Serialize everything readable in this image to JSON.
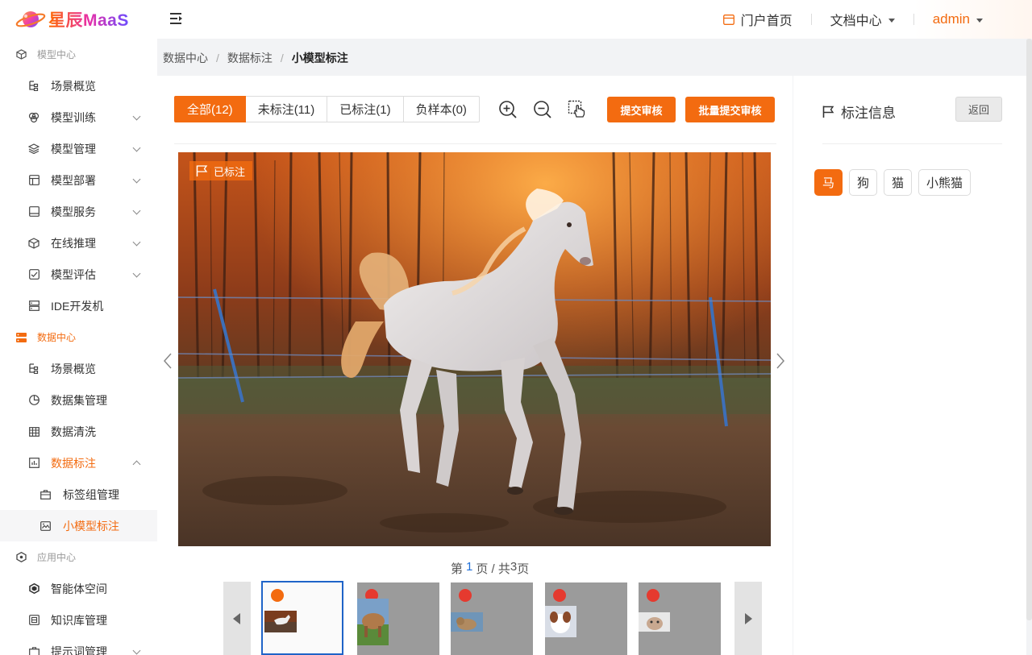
{
  "header": {
    "brand": "星辰MaaS",
    "nav": [
      {
        "label": "门户首页",
        "icon": "portal-icon"
      },
      {
        "label": "文档中心",
        "icon": "chevron-down-icon"
      }
    ],
    "user": "admin",
    "accent_color": "#f36b10"
  },
  "sidebar": {
    "groups": [
      {
        "label": "模型中心",
        "icon": "cube-icon",
        "items": [
          {
            "label": "场景概览",
            "icon": "tree-icon"
          },
          {
            "label": "模型训练",
            "icon": "training-icon"
          },
          {
            "label": "模型管理",
            "icon": "layers-icon"
          },
          {
            "label": "模型部署",
            "icon": "deploy-icon"
          },
          {
            "label": "模型服务",
            "icon": "service-icon"
          },
          {
            "label": "在线推理",
            "icon": "inference-icon"
          },
          {
            "label": "模型评估",
            "icon": "evaluate-icon"
          },
          {
            "label": "IDE开发机",
            "icon": "server-icon"
          }
        ]
      },
      {
        "label": "数据中心",
        "icon": "database-icon",
        "items": [
          {
            "label": "场景概览",
            "icon": "tree-icon"
          },
          {
            "label": "数据集管理",
            "icon": "pie-icon"
          },
          {
            "label": "数据清洗",
            "icon": "table-icon"
          },
          {
            "label": "数据标注",
            "icon": "chart-icon"
          }
        ],
        "subitems": [
          {
            "label": "标签组管理",
            "icon": "briefcase-icon"
          },
          {
            "label": "小模型标注",
            "icon": "image-label-icon"
          }
        ]
      },
      {
        "label": "应用中心",
        "icon": "hex-icon",
        "items": [
          {
            "label": "智能体空间",
            "icon": "agent-icon"
          },
          {
            "label": "知识库管理",
            "icon": "knowledge-icon"
          },
          {
            "label": "提示词管理",
            "icon": "prompt-icon"
          }
        ]
      }
    ]
  },
  "breadcrumb": [
    "数据中心",
    "数据标注",
    "小模型标注"
  ],
  "filters": {
    "tabs": [
      "全部(12)",
      "未标注(11)",
      "已标注(1)",
      "负样本(0)"
    ],
    "active_index": 0
  },
  "toolbar": {
    "zoom_in_icon": "zoom-in-icon",
    "zoom_out_icon": "zoom-out-icon",
    "pan_icon": "hand-pointer-icon",
    "submit_label": "提交审核",
    "batch_submit_label": "批量提交审核"
  },
  "viewer": {
    "status_badge": "已标注",
    "image_subject": "white horse running in paddock at sunset"
  },
  "pager": {
    "prefix": "第",
    "current": "1",
    "mid": "页 / 共",
    "total": "3",
    "suffix": "页"
  },
  "thumbnails": [
    {
      "subject": "horse",
      "status": "labeled"
    },
    {
      "subject": "cow",
      "status": "unlabeled"
    },
    {
      "subject": "cat",
      "status": "unlabeled"
    },
    {
      "subject": "dog",
      "status": "unlabeled"
    },
    {
      "subject": "kitten",
      "status": "unlabeled"
    }
  ],
  "annotation_panel": {
    "title": "标注信息",
    "back_label": "返回",
    "labels": [
      "马",
      "狗",
      "猫",
      "小熊猫"
    ],
    "active_index": 0
  }
}
